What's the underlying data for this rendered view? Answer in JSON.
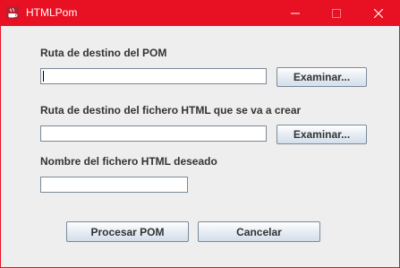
{
  "window": {
    "title": "HTMLPom",
    "accent": "#e81123"
  },
  "form": {
    "pom_path_label": "Ruta de destino del POM",
    "pom_path_value": "",
    "browse_pom_label": "Examinar...",
    "html_path_label": "Ruta de destino del fichero HTML que se va a crear",
    "html_path_value": "",
    "browse_html_label": "Examinar...",
    "html_name_label": "Nombre del fichero HTML deseado",
    "html_name_value": ""
  },
  "actions": {
    "process_label": "Procesar POM",
    "cancel_label": "Cancelar"
  }
}
